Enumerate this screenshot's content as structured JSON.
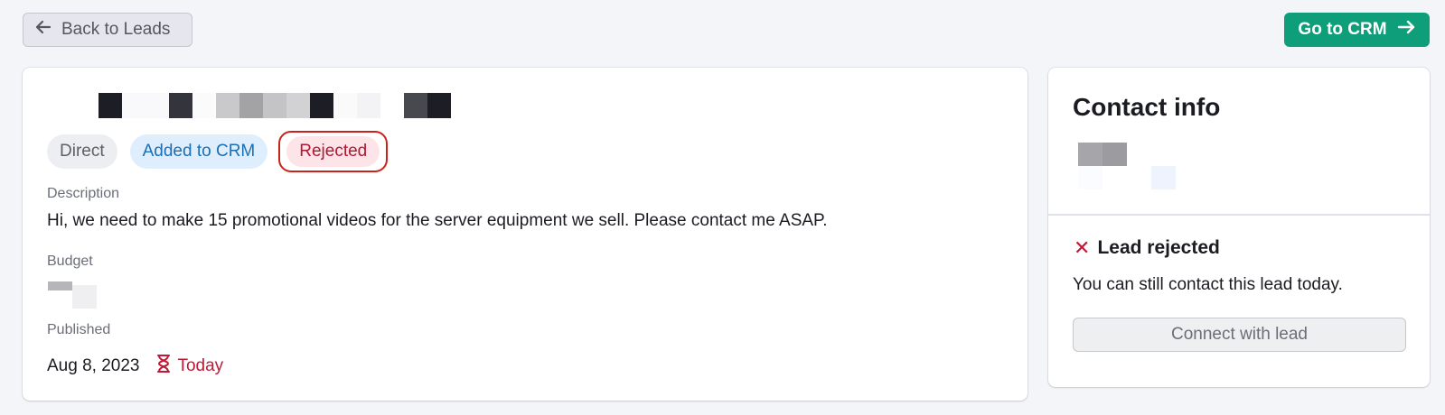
{
  "header": {
    "back_label": "Back to Leads",
    "crm_label": "Go to CRM"
  },
  "lead": {
    "tags": {
      "direct": "Direct",
      "crm": "Added to CRM",
      "rejected": "Rejected"
    },
    "description_label": "Description",
    "description": "Hi, we need to make 15 promotional videos for the server equipment we sell. Please contact me ASAP.",
    "budget_label": "Budget",
    "published_label": "Published",
    "published_date": "Aug 8, 2023",
    "published_relative": "Today"
  },
  "contact": {
    "title": "Contact info",
    "status_title": "Lead rejected",
    "status_text": "You can still contact this lead today.",
    "connect_label": "Connect with lead"
  },
  "colors": {
    "accent_green": "#0e9f7a",
    "rejected_red": "#c01936",
    "crm_blue": "#1b6fb5"
  },
  "icons": [
    "arrow-left-icon",
    "arrow-right-icon",
    "hourglass-icon",
    "close-icon"
  ]
}
